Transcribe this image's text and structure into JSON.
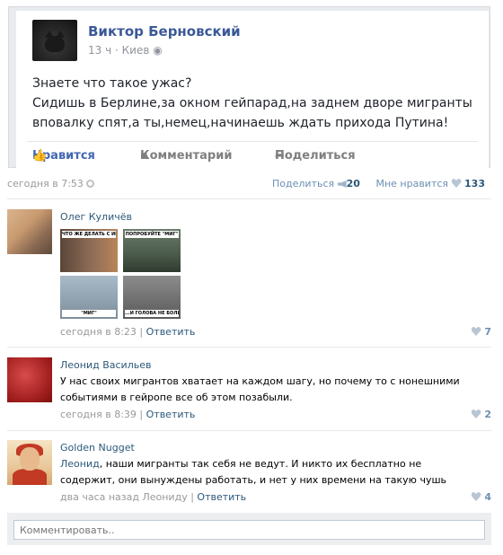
{
  "fb_post": {
    "author": "Виктор Берновский",
    "time": "13 ч",
    "location": "Киев",
    "lines": [
      "Знаете что такое ужас?",
      "Сидишь в Берлине,за окном гейпарад,на заднем дворе мигранты",
      "вповалку спят,а ты,немец,начинаешь ждать прихода Путина!"
    ],
    "actions": {
      "like": "Нравится",
      "comment": "Комментарий",
      "share": "Поделиться"
    }
  },
  "post": {
    "time": "сегодня в 7:53",
    "share_label": "Поделиться",
    "share_count": "20",
    "like_label": "Мне нравится",
    "like_count": "133"
  },
  "comments": [
    {
      "author": "Олег Куличёв",
      "meme": {
        "captions": [
          "ЧТО ЖЕ ДЕЛАТЬ С ИГИЛ, УМА НЕ ПРИЛОЖУ, ГОЛОВА ОТ НИХ БОЛИТ",
          "ПОПРОБУЙТЕ \"МИГ\"",
          "\"МИГ\"",
          "...И ГОЛОВА НЕ БОЛИТ"
        ]
      },
      "time": "сегодня в 8:23",
      "reply": "Ответить",
      "likes": "7"
    },
    {
      "author": "Леонид Васильев",
      "text": "У нас своих мигрантов хватает на каждом шагу, но почему то с нонешними событиями в гейропе все об этом позабыли.",
      "time": "сегодня в 8:39",
      "reply": "Ответить",
      "likes": "2"
    },
    {
      "author": "Golden Nugget",
      "mention": "Леонид",
      "text": ", наши мигранты так себя не ведут. И никто их бесплатно не содержит, они вынуждены работать, и нет у них времени на такую чушь",
      "time": "два часа назад Леониду",
      "reply": "Ответить",
      "likes": "4"
    }
  ],
  "comment_input": {
    "placeholder": "Комментировать.."
  },
  "colors": {
    "link": "#2b587a",
    "fb_blue": "#3b5998",
    "muted": "#999999"
  }
}
